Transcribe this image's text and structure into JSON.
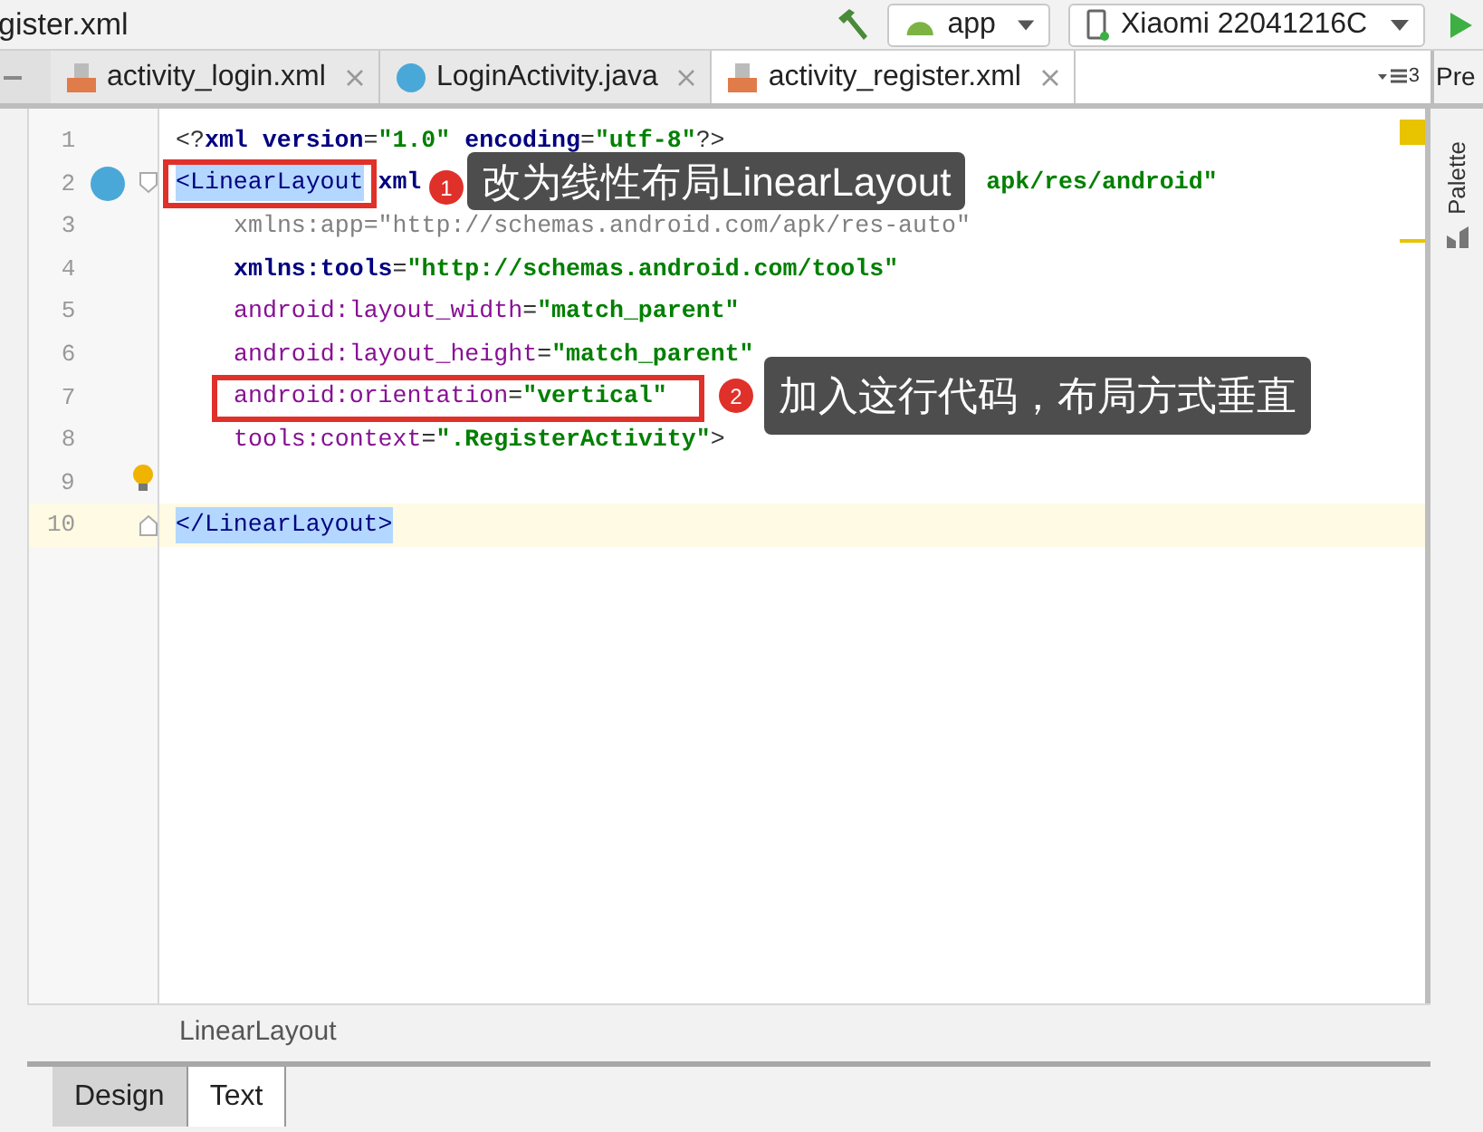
{
  "toolbar": {
    "file_title": "gister.xml",
    "run_config": "app",
    "device": "Xiaomi 22041216C"
  },
  "tabs": [
    {
      "label": "activity_login.xml",
      "kind": "xml",
      "selected": false
    },
    {
      "label": "LoginActivity.java",
      "kind": "class",
      "selected": false
    },
    {
      "label": "activity_register.xml",
      "kind": "xml",
      "selected": true
    }
  ],
  "tab_overflow_count": "3",
  "side_panel_cut": "Pre",
  "editor": {
    "lines": [
      {
        "number": "1",
        "tokens": [
          {
            "kind": "punct",
            "text": "<?"
          },
          {
            "kind": "ns",
            "text": "xml version"
          },
          {
            "kind": "punct",
            "text": "="
          },
          {
            "kind": "value",
            "text": "\"1.0\""
          },
          {
            "kind": "ns",
            "text": " encoding"
          },
          {
            "kind": "punct",
            "text": "="
          },
          {
            "kind": "value",
            "text": "\"utf-8\""
          },
          {
            "kind": "punct",
            "text": "?>"
          }
        ]
      },
      {
        "number": "2",
        "gutter_icon": {
          "kind": "class"
        },
        "fold": {
          "kind": "start"
        },
        "tokens": [
          {
            "kind": "match",
            "text": "<LinearLayout"
          },
          {
            "kind": "ns",
            "text": " xml"
          },
          {
            "kind": "tail",
            "text": "apk/res/android\""
          }
        ]
      },
      {
        "number": "3",
        "indented": true,
        "tokens": [
          {
            "kind": "unused",
            "text": "xmlns:app=\"http://schemas.android.com/apk/res-auto\""
          }
        ]
      },
      {
        "number": "4",
        "indented": true,
        "tokens": [
          {
            "kind": "ns",
            "text": "xmlns:tools"
          },
          {
            "kind": "punct",
            "text": "="
          },
          {
            "kind": "value",
            "text": "\"http://schemas.android.com/tools\""
          }
        ]
      },
      {
        "number": "5",
        "indented": true,
        "tokens": [
          {
            "kind": "attr",
            "text": "android:layout_width"
          },
          {
            "kind": "punct",
            "text": "="
          },
          {
            "kind": "value",
            "text": "\"match_parent\""
          }
        ]
      },
      {
        "number": "6",
        "indented": true,
        "tokens": [
          {
            "kind": "attr",
            "text": "android:layout_height"
          },
          {
            "kind": "punct",
            "text": "="
          },
          {
            "kind": "value",
            "text": "\"match_parent\""
          }
        ]
      },
      {
        "number": "7",
        "indented": true,
        "tokens": [
          {
            "kind": "attr",
            "text": "android:orientation"
          },
          {
            "kind": "punct",
            "text": "="
          },
          {
            "kind": "value",
            "text": "\"vertical\""
          }
        ]
      },
      {
        "number": "8",
        "indented": true,
        "tokens": [
          {
            "kind": "attr",
            "text": "tools:context"
          },
          {
            "kind": "punct",
            "text": "="
          },
          {
            "kind": "value",
            "text": "\".RegisterActivity\""
          },
          {
            "kind": "punct",
            "text": ">"
          }
        ]
      },
      {
        "number": "9",
        "gutter_icon": {
          "kind": "bulb"
        }
      },
      {
        "number": "10",
        "fold": {
          "kind": "end"
        },
        "current": true,
        "tokens": [
          {
            "kind": "match",
            "text": "</LinearLayout>"
          }
        ]
      }
    ]
  },
  "annotations": [
    {
      "badge": "1",
      "text": "改为线性布局LinearLayout"
    },
    {
      "badge": "2",
      "text": "加入这行代码，布局方式垂直"
    }
  ],
  "breadcrumb": "LinearLayout",
  "bottom_tabs": [
    {
      "label": "Design",
      "selected": false
    },
    {
      "label": "Text",
      "selected": true
    }
  ],
  "right_panel": {
    "label": "Palette"
  }
}
